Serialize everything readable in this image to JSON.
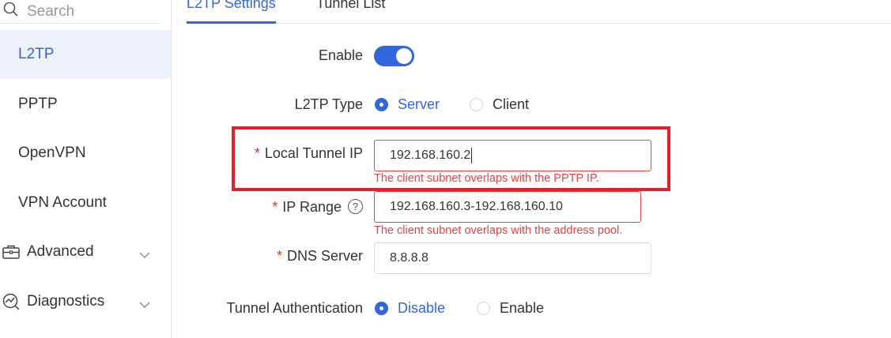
{
  "sidebar": {
    "search_placeholder": "Search",
    "items": [
      {
        "label": "L2TP"
      },
      {
        "label": "PPTP"
      },
      {
        "label": "OpenVPN"
      },
      {
        "label": "VPN Account"
      }
    ],
    "groups": [
      {
        "label": "Advanced",
        "icon": "briefcase-icon"
      },
      {
        "label": "Diagnostics",
        "icon": "diagnostics-icon"
      }
    ]
  },
  "tabs": [
    {
      "label": "L2TP Settings"
    },
    {
      "label": "Tunnel List"
    }
  ],
  "form": {
    "enable_label": "Enable",
    "l2tp_type_label": "L2TP Type",
    "l2tp_type_options": [
      "Server",
      "Client"
    ],
    "local_tunnel_ip_label": "Local Tunnel IP",
    "local_tunnel_ip_value": "192.168.160.2",
    "local_tunnel_ip_error": "The client subnet overlaps with the PPTP IP.",
    "ip_range_label": "IP Range",
    "ip_range_value": "192.168.160.3-192.168.160.10",
    "ip_range_error": "The client subnet overlaps with the address pool.",
    "dns_server_label": "DNS Server",
    "dns_server_value": "8.8.8.8",
    "tunnel_auth_label": "Tunnel Authentication",
    "tunnel_auth_options": [
      "Disable",
      "Enable"
    ],
    "required_mark": "*",
    "help_mark": "?"
  },
  "colors": {
    "accent": "#3366dd",
    "error": "#e04545",
    "highlight": "#e0202a"
  }
}
